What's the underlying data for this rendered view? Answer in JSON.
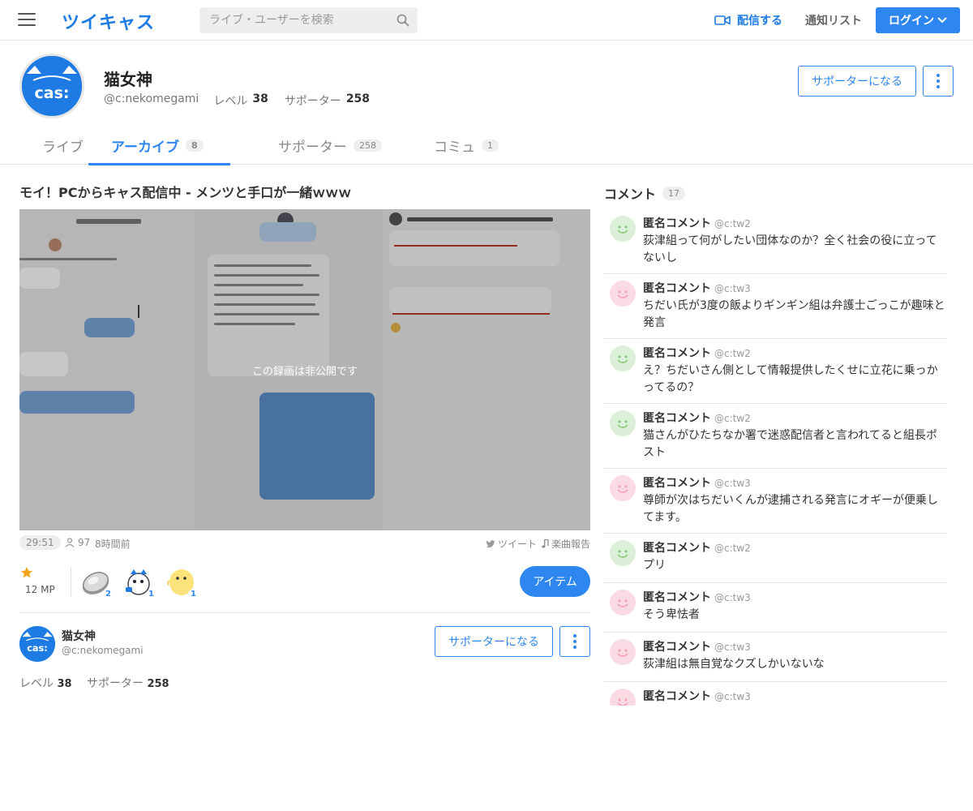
{
  "header": {
    "logo": "ツイキャス",
    "search_placeholder": "ライブ・ユーザーを検索",
    "broadcast_label": "配信する",
    "notify_label": "通知リスト",
    "login_label": "ログイン"
  },
  "profile": {
    "name": "猫女神",
    "handle": "@c:nekomegami",
    "level_label": "レベル",
    "level": "38",
    "supporters_label": "サポーター",
    "supporters": "258",
    "supporter_button": "サポーターになる"
  },
  "tabs": [
    {
      "label": "ライブ",
      "count": ""
    },
    {
      "label": "アーカイブ",
      "count": "8"
    },
    {
      "label": "サポーター",
      "count": "258"
    },
    {
      "label": "コミュ",
      "count": "1"
    }
  ],
  "video": {
    "title": "モイ！PCからキャス配信中 - メンツと手口が一緒ｗｗｗ",
    "private_label": "この録画は非公開です",
    "duration": "29:51",
    "views": "97",
    "ago": "8時間前",
    "tweet_label": "ツイート",
    "report_label": "楽曲報告",
    "mp": "12 MP",
    "items": [
      {
        "icon": "coin-item-icon",
        "count": "2"
      },
      {
        "icon": "mascot-item-icon",
        "count": "1"
      },
      {
        "icon": "chick-item-icon",
        "count": "1"
      }
    ],
    "item_button": "アイテム"
  },
  "owner": {
    "name": "猫女神",
    "handle": "@c:nekomegami",
    "supporter_button": "サポーターになる",
    "level_label": "レベル",
    "level": "38",
    "supporters_label": "サポーター",
    "supporters": "258"
  },
  "comments": {
    "title": "コメント",
    "count": "17",
    "items": [
      {
        "name": "匿名コメント",
        "id": "@c:tw2",
        "text": "荻津組って何がしたい団体なのか？全く社会の役に立ってないし",
        "avatar": "green"
      },
      {
        "name": "匿名コメント",
        "id": "@c:tw3",
        "text": "ちだい氏が3度の飯よりギンギン組は弁護士ごっこが趣味と発言",
        "avatar": "pink"
      },
      {
        "name": "匿名コメント",
        "id": "@c:tw2",
        "text": "え？ちだいさん側として情報提供したくせに立花に乗っかってるの？",
        "avatar": "green"
      },
      {
        "name": "匿名コメント",
        "id": "@c:tw2",
        "text": "猫さんがひたちなか署で迷惑配信者と言われてると組長ポスト",
        "avatar": "green"
      },
      {
        "name": "匿名コメント",
        "id": "@c:tw3",
        "text": "尊師が次はちだいくんが逮捕される発言にオギーが便乗してます。",
        "avatar": "pink"
      },
      {
        "name": "匿名コメント",
        "id": "@c:tw2",
        "text": "プリ",
        "avatar": "green"
      },
      {
        "name": "匿名コメント",
        "id": "@c:tw3",
        "text": "そう卑怯者",
        "avatar": "pink"
      },
      {
        "name": "匿名コメント",
        "id": "@c:tw3",
        "text": "荻津組は無自覚なクズしかいないな",
        "avatar": "pink"
      },
      {
        "name": "匿名コメント",
        "id": "@c:tw3",
        "text": "",
        "avatar": "pink"
      }
    ]
  },
  "colors": {
    "accent": "#2e86f0",
    "logo": "#1d7be3",
    "smile_green": "#8cc97e",
    "smile_pink": "#f2a3b5"
  }
}
